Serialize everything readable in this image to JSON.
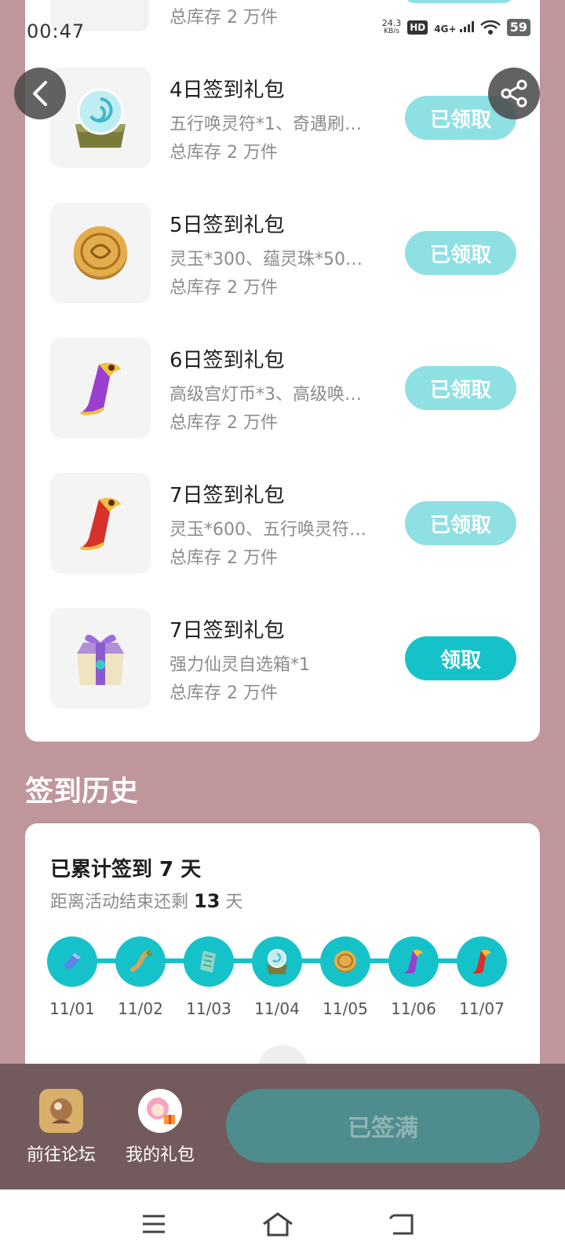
{
  "status_bar": {
    "time": "00:47",
    "net_speed": "24.3",
    "net_unit": "KB/s",
    "hd": "HD",
    "network": "4G+",
    "battery": "59"
  },
  "partial_item": {
    "stock": "总库存 2 万件"
  },
  "gift_items": [
    {
      "title": "4日签到礼包",
      "desc": "五行唤灵符*1、奇遇刷…",
      "stock": "总库存 2 万件",
      "button": "已领取",
      "claimed": true
    },
    {
      "title": "5日签到礼包",
      "desc": "灵玉*300、蕴灵珠*50…",
      "stock": "总库存 2 万件",
      "button": "已领取",
      "claimed": true
    },
    {
      "title": "6日签到礼包",
      "desc": "高级宫灯币*3、高级唤…",
      "stock": "总库存 2 万件",
      "button": "已领取",
      "claimed": true
    },
    {
      "title": "7日签到礼包",
      "desc": "灵玉*600、五行唤灵符…",
      "stock": "总库存 2 万件",
      "button": "已领取",
      "claimed": true
    },
    {
      "title": "7日签到礼包",
      "desc": "强力仙灵自选箱*1",
      "stock": "总库存 2 万件",
      "button": "领取",
      "claimed": false
    }
  ],
  "history": {
    "heading": "签到历史",
    "title": "已累计签到 7 天",
    "sub_prefix": "距离活动结束还剩",
    "days_left": "13",
    "sub_suffix": "天",
    "days": [
      {
        "date": "11/01",
        "icon": "crystal-icon"
      },
      {
        "date": "11/02",
        "icon": "ginseng-icon"
      },
      {
        "date": "11/03",
        "icon": "jade-talisman-icon"
      },
      {
        "date": "11/04",
        "icon": "spirit-orb-icon"
      },
      {
        "date": "11/05",
        "icon": "gold-coin-icon"
      },
      {
        "date": "11/06",
        "icon": "purple-scroll-icon"
      },
      {
        "date": "11/07",
        "icon": "red-scroll-icon"
      }
    ]
  },
  "bottom_bar": {
    "forum_label": "前往论坛",
    "gifts_label": "我的礼包",
    "signed_label": "已签满"
  },
  "colors": {
    "page_bg": "#bf969a",
    "accent": "#16c2c9",
    "accent_muted": "#8ee0e3",
    "bottom_bar": "#735a5c"
  }
}
